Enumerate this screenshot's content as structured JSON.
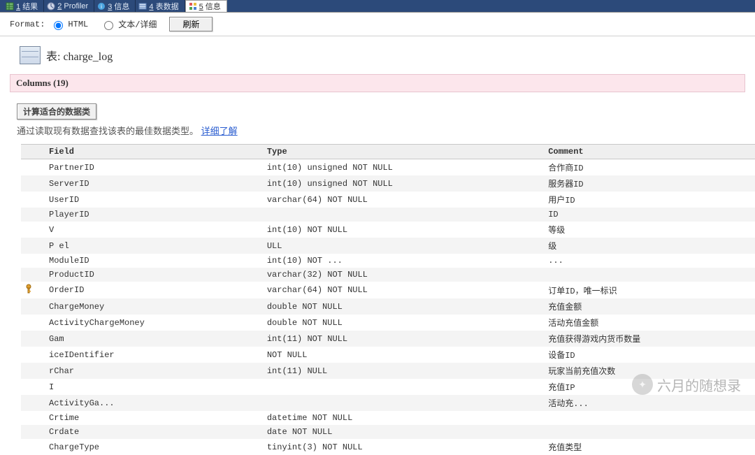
{
  "tabs": [
    {
      "num": "1",
      "label": "结果"
    },
    {
      "num": "2",
      "label": "Profiler"
    },
    {
      "num": "3",
      "label": "信息"
    },
    {
      "num": "4",
      "label": "表数据"
    },
    {
      "num": "5",
      "label": "信息"
    }
  ],
  "active_tab_index": 4,
  "format": {
    "label": "Format:",
    "html": "HTML",
    "text": "文本/详细",
    "refresh": "刷新"
  },
  "title_prefix": "表: ",
  "table_name": "charge_log",
  "columns_header_prefix": "Columns (",
  "columns_count": "19",
  "columns_header_suffix": ")",
  "calc_button": "计算适合的数据类",
  "hint": "通过读取现有数据查找该表的最佳数据类型。 ",
  "hint_link": "详细了解",
  "headers": {
    "field": "Field",
    "type": "Type",
    "comment": "Comment"
  },
  "rows": [
    {
      "key": false,
      "field": "PartnerID",
      "type": "int(10) unsigned NOT NULL",
      "comment": "合作商ID"
    },
    {
      "key": false,
      "field": "ServerID",
      "type": "int(10) unsigned NOT NULL",
      "comment": "服务器ID"
    },
    {
      "key": false,
      "field": "UserID",
      "type": "varchar(64) NOT NULL",
      "comment": "用户ID"
    },
    {
      "key": false,
      "field": "PlayerID",
      "type": "",
      "comment": "ID"
    },
    {
      "key": false,
      "field": "V",
      "type": "int(10) NOT NULL",
      "comment": "等级"
    },
    {
      "key": false,
      "field": "P         el",
      "type": "        ULL",
      "comment": "级"
    },
    {
      "key": false,
      "field": "ModuleID",
      "type": "int(10) NOT ...",
      "comment": "..."
    },
    {
      "key": false,
      "field": "ProductID",
      "type": "varchar(32) NOT NULL",
      "comment": ""
    },
    {
      "key": true,
      "field": "OrderID",
      "type": "varchar(64) NOT NULL",
      "comment": "订单ID，唯一标识"
    },
    {
      "key": false,
      "field": "ChargeMoney",
      "type": "double NOT NULL",
      "comment": "充值金额"
    },
    {
      "key": false,
      "field": "ActivityChargeMoney",
      "type": "double NOT NULL",
      "comment": "活动充值金额"
    },
    {
      "key": false,
      "field": "Gam",
      "type": "int(11) NOT NULL",
      "comment": "充值获得游戏内货币数量"
    },
    {
      "key": false,
      "field": "   iceIDentifier",
      "type": "        NOT NULL",
      "comment": "设备ID"
    },
    {
      "key": false,
      "field": "  rChar",
      "type": "int(11) NULL",
      "comment": "玩家当前充值次数"
    },
    {
      "key": false,
      "field": "I",
      "type": "",
      "comment": "充值IP"
    },
    {
      "key": false,
      "field": "ActivityGa...",
      "type": "",
      "comment": "活动充..."
    },
    {
      "key": false,
      "field": "Crtime",
      "type": "datetime NOT NULL",
      "comment": ""
    },
    {
      "key": false,
      "field": "Crdate",
      "type": "date NOT NULL",
      "comment": ""
    },
    {
      "key": false,
      "field": "ChargeType",
      "type": "tinyint(3) NOT NULL",
      "comment": "充值类型"
    }
  ],
  "watermark": "六月的随想录"
}
